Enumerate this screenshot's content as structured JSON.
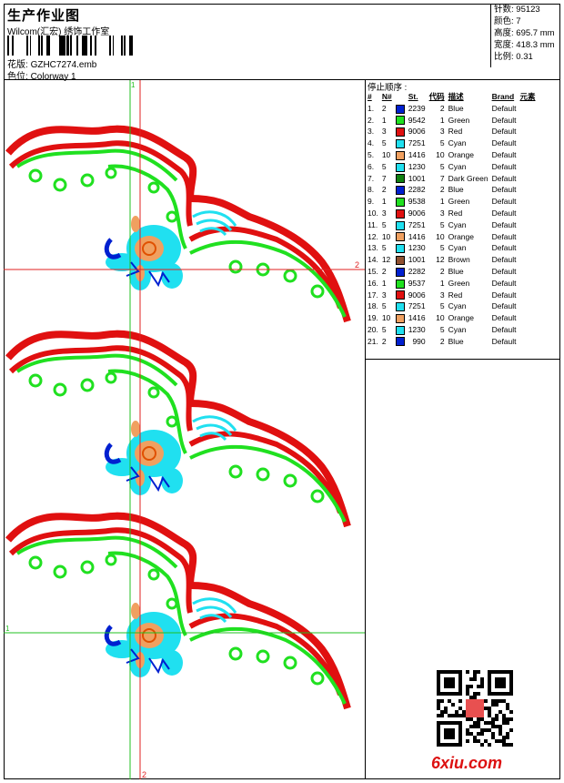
{
  "header": {
    "title": "生产作业图",
    "company": "Wilcom(汇宏) 绣饰工作室",
    "design_label": "花版:",
    "design_value": "GZHC7274.emb",
    "colorway_label": "色位:",
    "colorway_value": "Colorway 1"
  },
  "stats": [
    {
      "label": "针数:",
      "value": "95123"
    },
    {
      "label": "颜色:",
      "value": "7"
    },
    {
      "label": "高度:",
      "value": "695.7 mm"
    },
    {
      "label": "宽度:",
      "value": "418.3 mm"
    },
    {
      "label": "比例:",
      "value": "0.31"
    }
  ],
  "sequence": {
    "title": "停止顺序 :",
    "columns": [
      "#",
      "N#",
      "St.",
      "代码",
      "描述",
      "Brand",
      "元素"
    ],
    "rows": [
      {
        "n": "1.",
        "nn": "2",
        "color": "#0020d0",
        "st": "2239",
        "code": "2",
        "desc": "Blue",
        "brand": "Default"
      },
      {
        "n": "2.",
        "nn": "1",
        "color": "#20e020",
        "st": "9542",
        "code": "1",
        "desc": "Green",
        "brand": "Default"
      },
      {
        "n": "3.",
        "nn": "3",
        "color": "#e01010",
        "st": "9006",
        "code": "3",
        "desc": "Red",
        "brand": "Default"
      },
      {
        "n": "4.",
        "nn": "5",
        "color": "#20e0f0",
        "st": "7251",
        "code": "5",
        "desc": "Cyan",
        "brand": "Default"
      },
      {
        "n": "5.",
        "nn": "10",
        "color": "#f0a060",
        "st": "1416",
        "code": "10",
        "desc": "Orange",
        "brand": "Default"
      },
      {
        "n": "6.",
        "nn": "5",
        "color": "#20e0f0",
        "st": "1230",
        "code": "5",
        "desc": "Cyan",
        "brand": "Default"
      },
      {
        "n": "7.",
        "nn": "7",
        "color": "#108010",
        "st": "1001",
        "code": "7",
        "desc": "Dark Green",
        "brand": "Default"
      },
      {
        "n": "8.",
        "nn": "2",
        "color": "#0020d0",
        "st": "2282",
        "code": "2",
        "desc": "Blue",
        "brand": "Default"
      },
      {
        "n": "9.",
        "nn": "1",
        "color": "#20e020",
        "st": "9538",
        "code": "1",
        "desc": "Green",
        "brand": "Default"
      },
      {
        "n": "10.",
        "nn": "3",
        "color": "#e01010",
        "st": "9006",
        "code": "3",
        "desc": "Red",
        "brand": "Default"
      },
      {
        "n": "11.",
        "nn": "5",
        "color": "#20e0f0",
        "st": "7251",
        "code": "5",
        "desc": "Cyan",
        "brand": "Default"
      },
      {
        "n": "12.",
        "nn": "10",
        "color": "#f0a060",
        "st": "1416",
        "code": "10",
        "desc": "Orange",
        "brand": "Default"
      },
      {
        "n": "13.",
        "nn": "5",
        "color": "#20e0f0",
        "st": "1230",
        "code": "5",
        "desc": "Cyan",
        "brand": "Default"
      },
      {
        "n": "14.",
        "nn": "12",
        "color": "#905030",
        "st": "1001",
        "code": "12",
        "desc": "Brown",
        "brand": "Default"
      },
      {
        "n": "15.",
        "nn": "2",
        "color": "#0020d0",
        "st": "2282",
        "code": "2",
        "desc": "Blue",
        "brand": "Default"
      },
      {
        "n": "16.",
        "nn": "1",
        "color": "#20e020",
        "st": "9537",
        "code": "1",
        "desc": "Green",
        "brand": "Default"
      },
      {
        "n": "17.",
        "nn": "3",
        "color": "#e01010",
        "st": "9006",
        "code": "3",
        "desc": "Red",
        "brand": "Default"
      },
      {
        "n": "18.",
        "nn": "5",
        "color": "#20e0f0",
        "st": "7251",
        "code": "5",
        "desc": "Cyan",
        "brand": "Default"
      },
      {
        "n": "19.",
        "nn": "10",
        "color": "#f0a060",
        "st": "1416",
        "code": "10",
        "desc": "Orange",
        "brand": "Default"
      },
      {
        "n": "20.",
        "nn": "5",
        "color": "#20e0f0",
        "st": "1230",
        "code": "5",
        "desc": "Cyan",
        "brand": "Default"
      },
      {
        "n": "21.",
        "nn": "2",
        "color": "#0020d0",
        "st": "990",
        "code": "2",
        "desc": "Blue",
        "brand": "Default"
      }
    ]
  },
  "guides": {
    "v1": "1",
    "v2": "2",
    "h2": "2",
    "h1": "1"
  },
  "watermark": "6xiu.com",
  "colors": {
    "red": "#e01010",
    "green": "#20e020",
    "cyan": "#20e0f0",
    "blue": "#0020d0",
    "orange": "#f0a060",
    "guide_green": "#20c020",
    "guide_red": "#e02020"
  }
}
